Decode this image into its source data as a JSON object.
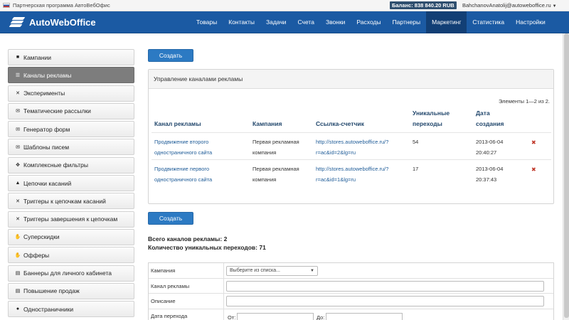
{
  "topbar": {
    "partner": "Партнерская программа АвтоВебОфис",
    "balance": "Баланс: 838 840.20 RUB",
    "user": "BahchanovAnatolij@autowebofficе.ru"
  },
  "brand": {
    "name": "AutoWebOffice"
  },
  "nav": [
    "Товары",
    "Контакты",
    "Задачи",
    "Счета",
    "Звонки",
    "Расходы",
    "Партнеры",
    "Маркетинг",
    "Статистика",
    "Настройки"
  ],
  "nav_active": "Маркетинг",
  "sidebar": [
    {
      "label": "Кампании",
      "icon": "briefcase-icon"
    },
    {
      "label": "Каналы рекламы",
      "icon": "list-icon",
      "active": true
    },
    {
      "label": "Эксперименты",
      "icon": "shuffle-icon"
    },
    {
      "label": "Тематические рассылки",
      "icon": "envelope-icon"
    },
    {
      "label": "Генератор форм",
      "icon": "envelope-icon"
    },
    {
      "label": "Шаблоны писем",
      "icon": "envelope-icon"
    },
    {
      "label": "Комплексные фильтры",
      "icon": "move-icon"
    },
    {
      "label": "Цепочки касаний",
      "icon": "road-icon"
    },
    {
      "label": "Триггеры к цепочкам касаний",
      "icon": "shuffle-icon"
    },
    {
      "label": "Триггеры завершения к цепочкам",
      "icon": "shuffle-icon"
    },
    {
      "label": "Суперскидки",
      "icon": "hand-icon"
    },
    {
      "label": "Офферы",
      "icon": "hand-icon"
    },
    {
      "label": "Баннеры для личного кабинета",
      "icon": "print-icon"
    },
    {
      "label": "Повышение продаж",
      "icon": "print-icon"
    },
    {
      "label": "Одностраничники",
      "icon": "globe-icon"
    }
  ],
  "create_button": "Создать",
  "panel": {
    "title": "Управление каналами рекламы",
    "elements": "Элементы 1—2 из 2.",
    "headers": {
      "channel": "Канал рекламы",
      "campaign": "Кампания",
      "link": "Ссылка-счетчик",
      "unique_1": "Уникальные",
      "unique_2": "переходы",
      "date_1": "Дата",
      "date_2": "создания"
    },
    "rows": [
      {
        "channel_1": "Продвижение второго",
        "channel_2": "одностраничного сайта",
        "campaign_1": "Первая рекламная",
        "campaign_2": "компания",
        "link_1": "http://stores.autowebofficе.ru/?",
        "link_2": "r=ac&id=2&lg=ru",
        "unique": "54",
        "date_1": "2013-06-04",
        "date_2": "20:40:27"
      },
      {
        "channel_1": "Продвижение первого",
        "channel_2": "одностраничного сайта",
        "campaign_1": "Первая рекламная",
        "campaign_2": "компания",
        "link_1": "http://stores.autowebofficе.ru/?",
        "link_2": "r=ac&id=1&lg=ru",
        "unique": "17",
        "date_1": "2013-06-04",
        "date_2": "20:37:43"
      }
    ]
  },
  "summary": {
    "total": "Всего каналов рекламы: 2",
    "unique": "Количество уникальных переходов: 71"
  },
  "form": {
    "campaign_label": "Кампания",
    "campaign_select": "Выберите из списка...",
    "channel_label": "Канал рекламы",
    "description_label": "Описание",
    "date_label": "Дата перехода",
    "from_label": "От:",
    "to_label": "До:"
  }
}
